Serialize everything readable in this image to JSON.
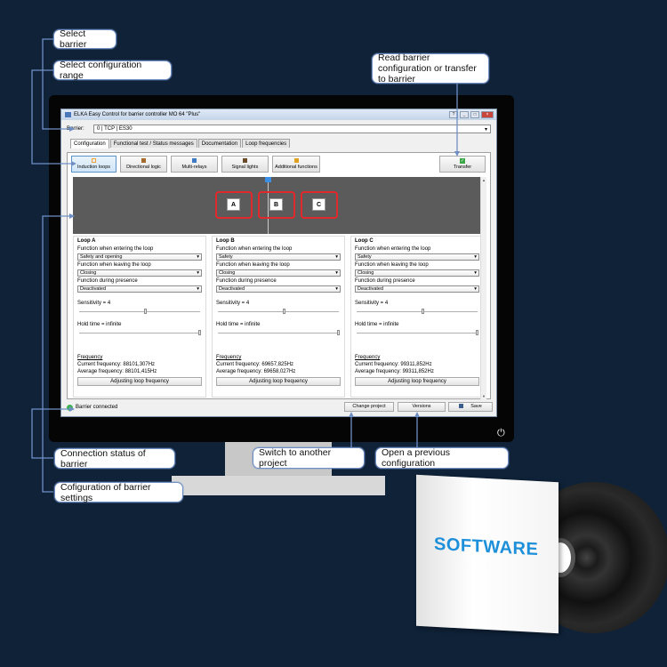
{
  "window": {
    "title": "ELKA Easy Control for barrier controller MO 64 \"Plus\"",
    "controls": [
      "?",
      "_",
      "□",
      "×"
    ]
  },
  "barrier": {
    "label": "Barrier:",
    "value": "0 | TCP | ES30"
  },
  "tabs": [
    "Configuration",
    "Functional test / Status messages",
    "Documentation",
    "Loop frequencies"
  ],
  "toolbar": {
    "buttons": [
      {
        "label": "Induction loops",
        "icon": "loop-icon",
        "color": "#f2a23a"
      },
      {
        "label": "Directional logic",
        "icon": "direction-icon",
        "color": "#a36b2c"
      },
      {
        "label": "Multi-relays",
        "icon": "relay-icon",
        "color": "#3e7bc4"
      },
      {
        "label": "Signal lights",
        "icon": "signal-light-icon",
        "color": "#6b4b2a"
      },
      {
        "label": "Additional functions",
        "icon": "pencil-icon",
        "color": "#e0a020"
      }
    ],
    "transfer_label": "Transfer",
    "transfer_icon": "✓"
  },
  "loop_panel": {
    "boxes": [
      "A",
      "B",
      "C"
    ]
  },
  "loops": [
    {
      "title": "Loop A",
      "entering_label": "Function when entering the loop",
      "entering_value": "Safety and opening",
      "leaving_label": "Function when leaving the loop",
      "leaving_value": "Closing",
      "presence_label": "Function during presence",
      "presence_value": "Deactivated",
      "sensitivity_label": "Sensitivity = 4",
      "sensitivity_level": 0.55,
      "hold_label": "Hold time = infinite",
      "hold_level": 1.0,
      "freq_title": "Frequency",
      "current_freq": "Current frequency: 88101,307Hz",
      "average_freq": "Average frequency: 88101,415Hz",
      "adjust_label": "Adjusting loop frequency"
    },
    {
      "title": "Loop B",
      "entering_label": "Function when entering the loop",
      "entering_value": "Safety",
      "leaving_label": "Function when leaving the loop",
      "leaving_value": "Closing",
      "presence_label": "Function during presence",
      "presence_value": "Deactivated",
      "sensitivity_label": "Sensitivity = 4",
      "sensitivity_level": 0.55,
      "hold_label": "Hold time = infinite",
      "hold_level": 1.0,
      "freq_title": "Frequency",
      "current_freq": "Current frequency: 69657,825Hz",
      "average_freq": "Average frequency: 69658,027Hz",
      "adjust_label": "Adjusting loop frequency"
    },
    {
      "title": "Loop C",
      "entering_label": "Function when entering the loop",
      "entering_value": "Safety",
      "leaving_label": "Function when leaving the loop",
      "leaving_value": "Closing",
      "presence_label": "Function during presence",
      "presence_value": "Deactivated",
      "sensitivity_label": "Sensitivity = 4",
      "sensitivity_level": 0.55,
      "hold_label": "Hold time = infinite",
      "hold_level": 1.0,
      "freq_title": "Frequency",
      "current_freq": "Current frequency: 99311,852Hz",
      "average_freq": "Average frequency: 99311,852Hz",
      "adjust_label": "Adjusting loop frequency"
    }
  ],
  "status": {
    "connection": "Barrier connected",
    "connection_color": "#3bb34a",
    "change_project": "Change project",
    "versions": "Versions",
    "save": "Save"
  },
  "callouts": {
    "select_barrier": "Select barrier",
    "select_range": "Select configuration range",
    "read_transfer": "Read barrier configuration or transfer to barrier",
    "connection_status": "Connection status of barrier",
    "configuration_settings": "Cofiguration of barrier settings",
    "switch_project": "Switch to another project",
    "previous_config": "Open a previous configuration"
  },
  "software_box": {
    "label": "SOFTWARE"
  },
  "accent_color": "#6f8fc4",
  "power_icon": "⏻"
}
